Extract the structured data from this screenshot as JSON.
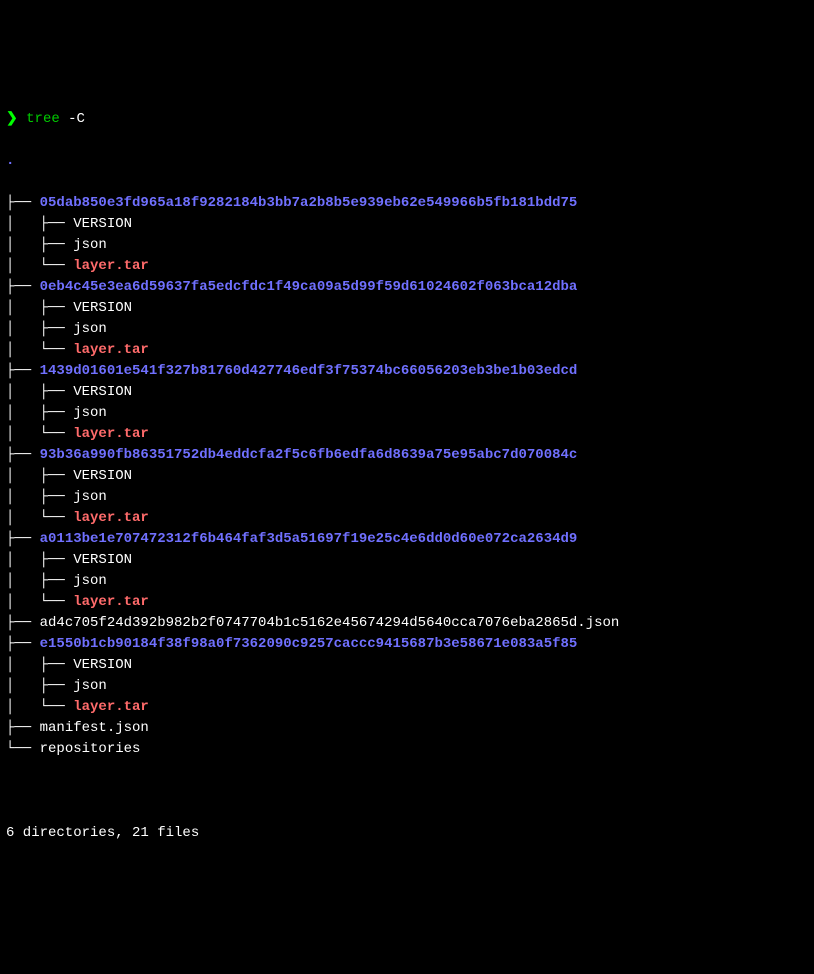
{
  "prompt": {
    "symbol": "❯",
    "command": "tree",
    "arg": "-C"
  },
  "root": ".",
  "tree": [
    {
      "name": "05dab850e3fd965a18f9282184b3bb7a2b8b5e939eb62e549966b5fb181bdd75",
      "type": "dir",
      "children": [
        {
          "name": "VERSION",
          "type": "file"
        },
        {
          "name": "json",
          "type": "file"
        },
        {
          "name": "layer.tar",
          "type": "tar"
        }
      ]
    },
    {
      "name": "0eb4c45e3ea6d59637fa5edcfdc1f49ca09a5d99f59d61024602f063bca12dba",
      "type": "dir",
      "children": [
        {
          "name": "VERSION",
          "type": "file"
        },
        {
          "name": "json",
          "type": "file"
        },
        {
          "name": "layer.tar",
          "type": "tar"
        }
      ]
    },
    {
      "name": "1439d01601e541f327b81760d427746edf3f75374bc66056203eb3be1b03edcd",
      "type": "dir",
      "children": [
        {
          "name": "VERSION",
          "type": "file"
        },
        {
          "name": "json",
          "type": "file"
        },
        {
          "name": "layer.tar",
          "type": "tar"
        }
      ]
    },
    {
      "name": "93b36a990fb86351752db4eddcfa2f5c6fb6edfa6d8639a75e95abc7d070084c",
      "type": "dir",
      "children": [
        {
          "name": "VERSION",
          "type": "file"
        },
        {
          "name": "json",
          "type": "file"
        },
        {
          "name": "layer.tar",
          "type": "tar"
        }
      ]
    },
    {
      "name": "a0113be1e707472312f6b464faf3d5a51697f19e25c4e6dd0d60e072ca2634d9",
      "type": "dir",
      "children": [
        {
          "name": "VERSION",
          "type": "file"
        },
        {
          "name": "json",
          "type": "file"
        },
        {
          "name": "layer.tar",
          "type": "tar"
        }
      ]
    },
    {
      "name": "ad4c705f24d392b982b2f0747704b1c5162e45674294d5640cca7076eba2865d.json",
      "type": "file"
    },
    {
      "name": "e1550b1cb90184f38f98a0f7362090c9257caccc9415687b3e58671e083a5f85",
      "type": "dir",
      "children": [
        {
          "name": "VERSION",
          "type": "file"
        },
        {
          "name": "json",
          "type": "file"
        },
        {
          "name": "layer.tar",
          "type": "tar"
        }
      ]
    },
    {
      "name": "manifest.json",
      "type": "file"
    },
    {
      "name": "repositories",
      "type": "file"
    }
  ],
  "summary": "6 directories, 21 files"
}
